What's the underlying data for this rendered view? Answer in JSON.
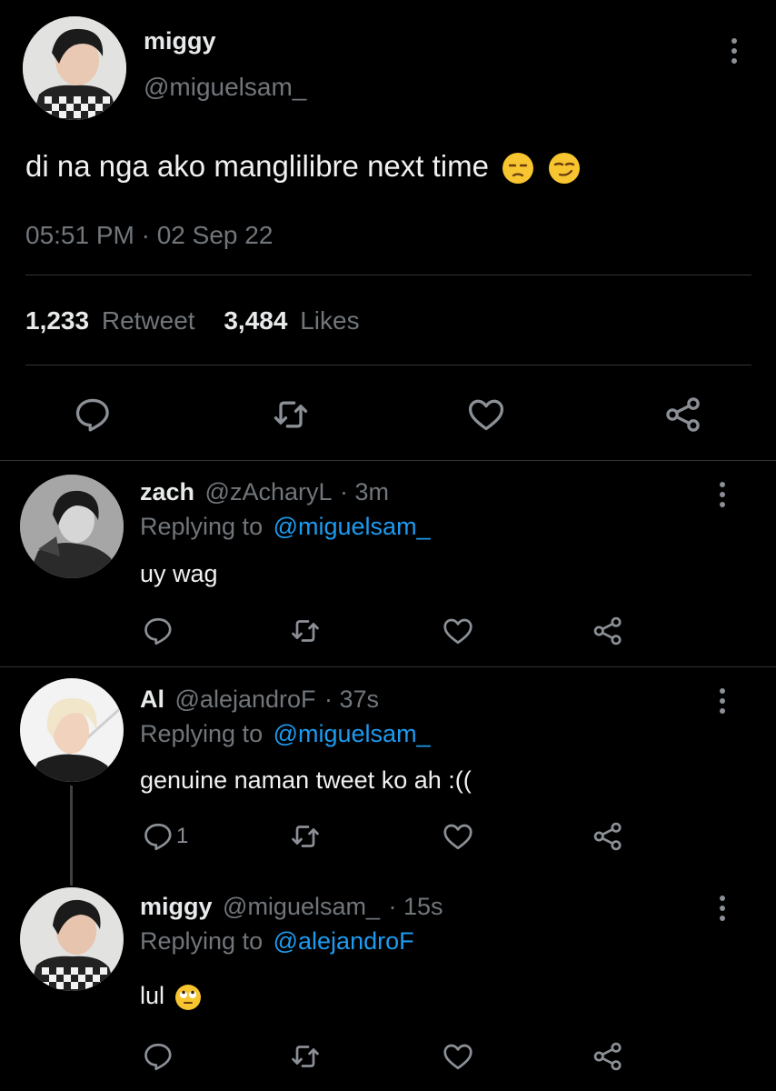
{
  "main_tweet": {
    "display_name": "miggy",
    "handle": "@miguelsam_",
    "text": "di na nga ako manglilibre next time",
    "emojis": [
      "unamused-face-emoji",
      "smirking-face-emoji"
    ],
    "timestamp": "05:51 PM · 02 Sep 22",
    "retweet_count": "1,233",
    "retweet_label": "Retweet",
    "like_count": "3,484",
    "like_label": "Likes"
  },
  "replies": [
    {
      "display_name": "zach",
      "handle": "@zAcharyL",
      "time": "· 3m",
      "replying_prefix": "Replying to",
      "replying_to": "@miguelsam_",
      "text": "uy wag",
      "reply_count": ""
    },
    {
      "display_name": "Al",
      "handle": "@alejandroF",
      "time": "· 37s",
      "replying_prefix": "Replying to",
      "replying_to": "@miguelsam_",
      "text": "genuine naman tweet ko ah :((",
      "reply_count": "1"
    },
    {
      "display_name": "miggy",
      "handle": "@miguelsam_",
      "time": "· 15s",
      "replying_prefix": "Replying to",
      "replying_to": "@alejandroF",
      "text": "lul",
      "emoji": "face-with-rolling-eyes-emoji",
      "reply_count": ""
    }
  ],
  "colors": {
    "background": "#000000",
    "text": "#e7e9ea",
    "muted": "#71767b",
    "link": "#1d9bf0",
    "divider": "#2f3336",
    "emoji": "#f7c52f"
  }
}
